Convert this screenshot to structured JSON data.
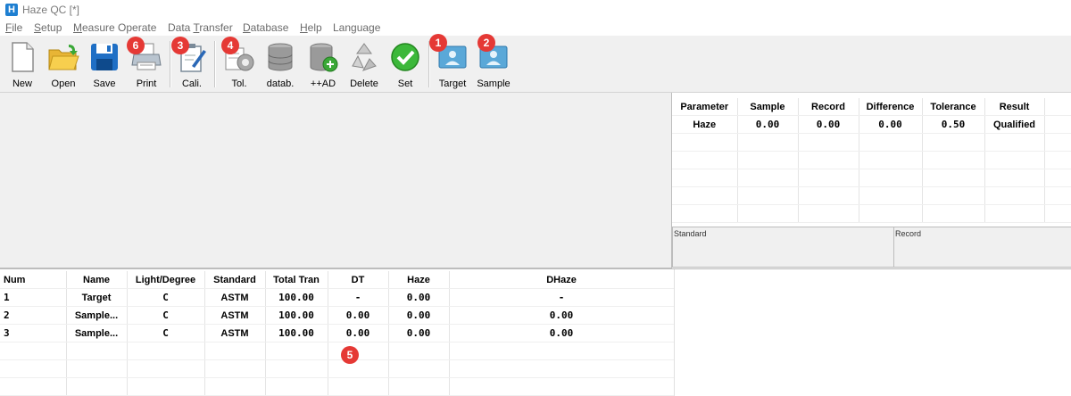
{
  "window": {
    "title": "Haze QC [*]",
    "logo_letter": "H"
  },
  "menu": [
    {
      "pre": "",
      "u": "F",
      "post": "ile"
    },
    {
      "pre": "",
      "u": "S",
      "post": "etup"
    },
    {
      "pre": "",
      "u": "M",
      "post": "easure Operate"
    },
    {
      "pre": "Data ",
      "u": "T",
      "post": "ransfer"
    },
    {
      "pre": "",
      "u": "D",
      "post": "atabase"
    },
    {
      "pre": "",
      "u": "H",
      "post": "elp"
    },
    {
      "pre": "",
      "u": "",
      "post": "Language"
    }
  ],
  "toolbar": {
    "new": "New",
    "open": "Open",
    "save": "Save",
    "print": "Print",
    "cali": "Cali.",
    "tol": "Tol.",
    "datab": "datab.",
    "add": "++AD",
    "delete": "Delete",
    "set": "Set",
    "target": "Target",
    "sample": "Sample"
  },
  "badges": {
    "b1": "1",
    "b2": "2",
    "b3": "3",
    "b4": "4",
    "b5": "5",
    "b6": "6"
  },
  "params_table": {
    "headers": [
      "Parameter",
      "Sample",
      "Record",
      "Difference",
      "Tolerance",
      "Result"
    ],
    "rows": [
      [
        "Haze",
        "0.00",
        "0.00",
        "0.00",
        "0.50",
        "Qualified"
      ]
    ]
  },
  "standard_label": "Standard",
  "record_label": "Record",
  "data_table": {
    "headers": [
      "Num",
      "Name",
      "Light/Degree",
      "Standard",
      "Total Tran",
      "DT",
      "Haze",
      "DHaze"
    ],
    "rows": [
      [
        "1",
        "Target",
        "C",
        "ASTM",
        "100.00",
        "-",
        "0.00",
        "-"
      ],
      [
        "2",
        "Sample...",
        "C",
        "ASTM",
        "100.00",
        "0.00",
        "0.00",
        "0.00"
      ],
      [
        "3",
        "Sample...",
        "C",
        "ASTM",
        "100.00",
        "0.00",
        "0.00",
        "0.00"
      ]
    ]
  },
  "colors": {
    "badge": "#e53935",
    "accent": "#1e7fd1"
  }
}
